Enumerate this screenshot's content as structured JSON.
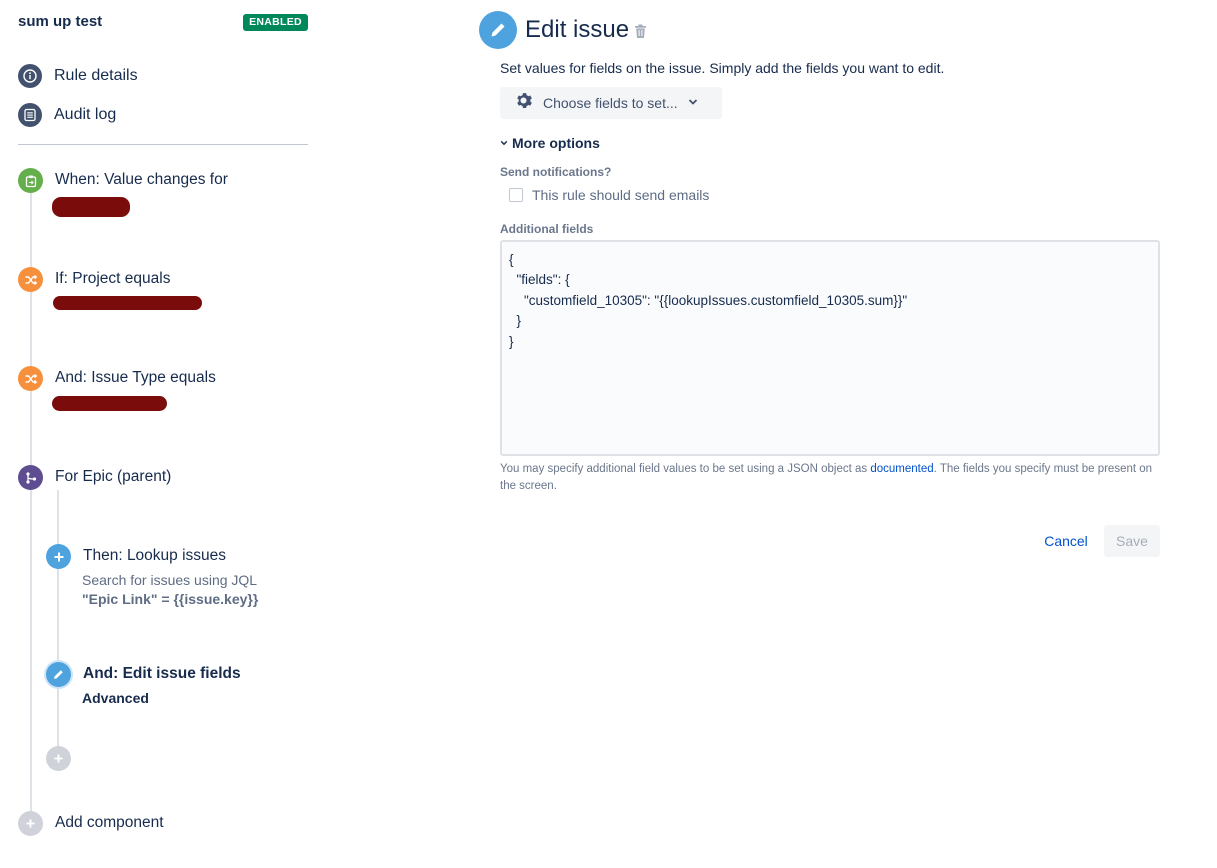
{
  "sidebar": {
    "rule_name": "sum up test",
    "status_badge": "ENABLED",
    "nav": [
      {
        "label": "Rule details",
        "icon": "info-icon"
      },
      {
        "label": "Audit log",
        "icon": "list-icon"
      }
    ],
    "components": [
      {
        "title": "When: Value changes for",
        "icon": "trigger-icon",
        "color": "#65ae4c"
      },
      {
        "title": "If: Project equals",
        "icon": "shuffle-icon",
        "color": "#f6903c"
      },
      {
        "title": "And: Issue Type equals",
        "icon": "shuffle-icon",
        "color": "#f6903c"
      },
      {
        "title": "For Epic (parent)",
        "icon": "branch-icon",
        "color": "#5e4d91"
      },
      {
        "title": "Then: Lookup issues",
        "subtitle": "Search for issues using JQL",
        "detail": "\"Epic Link\" = {{issue.key}}",
        "icon": "plus-icon",
        "color": "#4ea3df"
      },
      {
        "title": "And: Edit issue fields",
        "subtitle": "Advanced",
        "icon": "pencil-icon",
        "color": "#4ea3df"
      }
    ],
    "add_component": "Add component"
  },
  "editor": {
    "title": "Edit issue",
    "description": "Set values for fields on the issue. Simply add the fields you want to edit.",
    "choose_fields": "Choose fields to set...",
    "more_options": "More options",
    "send_notifications_label": "Send notifications?",
    "send_emails_checkbox": "This rule should send emails",
    "send_emails_checked": false,
    "additional_fields_label": "Additional fields",
    "additional_fields_value": "{\n  \"fields\": {\n    \"customfield_10305\": \"{{lookupIssues.customfield_10305.sum}}\"\n  }\n}",
    "help_text_before": "You may specify additional field values to be set using a JSON object as ",
    "help_link": "documented",
    "help_text_after": ". The fields you specify must be present on the screen.",
    "cancel": "Cancel",
    "save": "Save"
  }
}
